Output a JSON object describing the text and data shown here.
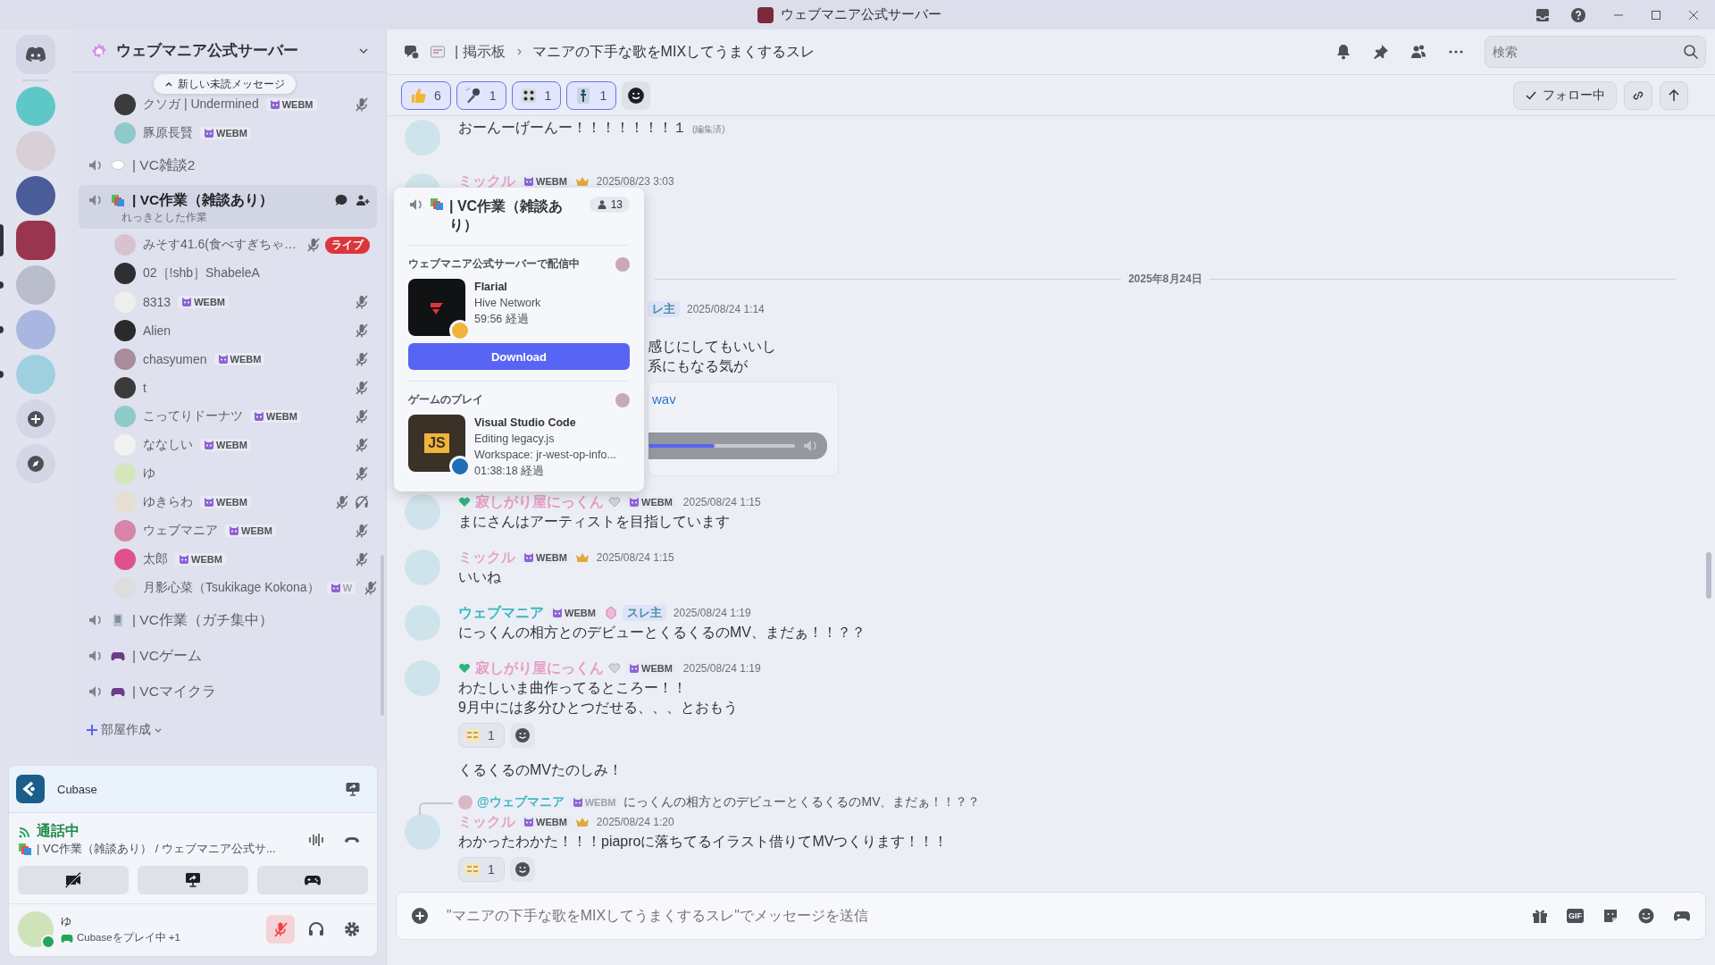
{
  "title_bar": {
    "title": "ウェブマニア公式サーバー"
  },
  "servers": [
    {
      "selected": false,
      "unread": false
    },
    {
      "selected": false,
      "unread": false
    },
    {
      "selected": false,
      "unread": false
    },
    {
      "selected": true,
      "unread": false
    },
    {
      "selected": false,
      "unread": true
    },
    {
      "selected": false,
      "unread": true
    },
    {
      "selected": false,
      "unread": true
    }
  ],
  "server": {
    "name": "ウェブマニア公式サーバー"
  },
  "new_messages_pill": "新しい未読メッセージ",
  "top_members": [
    {
      "name": "クソガ | Undermined",
      "tag": "WEBM",
      "muted": true,
      "deafened": false
    },
    {
      "name": "豚原長賢",
      "tag": "WEBM",
      "muted": false,
      "deafened": false
    }
  ],
  "channels": [
    {
      "name": "| VC雑談2",
      "kind": "speech",
      "selected": false
    },
    {
      "name": "| VC作業（雑談あり）",
      "kind": "books",
      "selected": true,
      "topic": "れっきとした作業",
      "members": [
        {
          "name": "みそす41.6(食べすぎちゃ…",
          "muted": true,
          "deafened": false,
          "live": "ライブ"
        },
        {
          "name": "02［!shb］ShabeleA",
          "muted": false,
          "deafened": false
        },
        {
          "name": "8313",
          "tag": "WEBM",
          "muted": true,
          "deafened": false
        },
        {
          "name": "Alien",
          "muted": true,
          "deafened": false
        },
        {
          "name": "chasyumen",
          "tag": "WEBM",
          "muted": true,
          "deafened": false
        },
        {
          "name": "t",
          "muted": true,
          "deafened": false
        },
        {
          "name": "こってりドーナツ",
          "tag": "WEBM",
          "muted": true,
          "deafened": false
        },
        {
          "name": "ななしい",
          "tag": "WEBM",
          "muted": true,
          "deafened": false
        },
        {
          "name": "ゆ",
          "muted": true,
          "deafened": false
        },
        {
          "name": "ゆきらわ",
          "tag": "WEBM",
          "muted": true,
          "deafened": true
        },
        {
          "name": "ウェブマニア",
          "tag": "WEBM",
          "muted": true,
          "deafened": false
        },
        {
          "name": "太郎",
          "tag": "WEBM",
          "muted": true,
          "deafened": false
        },
        {
          "name": "月影心菜（Tsukikage Kokona）",
          "tag": "W",
          "muted": true,
          "deafened": false
        }
      ]
    },
    {
      "name": "| VC作業（ガチ集中）",
      "kind": "building",
      "selected": false
    },
    {
      "name": "| VCゲーム",
      "kind": "gamepad",
      "selected": false
    },
    {
      "name": "| VCマイクラ",
      "kind": "gamepad",
      "selected": false
    }
  ],
  "create_room": "部屋作成",
  "voice_panel": {
    "activity": "Cubase",
    "status": "通話中",
    "location": "| VC作業（雑談あり） / ウェブマニア公式サ...",
    "camera_on": false
  },
  "user": {
    "name": "ゆ",
    "activity": "Cubaseをプレイ中 +1",
    "online": true,
    "mic_muted": true
  },
  "header": {
    "channel": "| 掲示板",
    "thread": "マニアの下手な歌をMIXしてうまくするスレ",
    "search": {
      "placeholder": "検索"
    }
  },
  "thread_reactions": [
    {
      "kind": "thumbs",
      "count": "6",
      "selected": true
    },
    {
      "kind": "mic",
      "count": "1",
      "selected": true
    },
    {
      "kind": "dice",
      "count": "1",
      "selected": true
    },
    {
      "kind": "figure",
      "count": "1",
      "selected": true
    }
  ],
  "follow_button": {
    "label": "フォロー中",
    "following": true
  },
  "messages": [
    {
      "kind": "text_only",
      "lines": [
        "おーんーげーんー！！！！！！！１"
      ],
      "edited": "(編集済)"
    },
    {
      "kind": "header_only",
      "author": "ミックル",
      "color": "#e3a6c8",
      "tag": "WEBM",
      "crown": true,
      "time": "2025/08/23 3:03"
    },
    {
      "kind": "divider",
      "label": "2025年8月24日"
    },
    {
      "kind": "partial",
      "badge": "レ主",
      "time": "2025/08/24 1:14",
      "lines": [
        "感じにしてもいいし",
        "系にもなる気が"
      ],
      "file": "wav",
      "level": 0.45
    },
    {
      "kind": "message",
      "author": "寂しがり屋にっくん",
      "color": "#e79cc3",
      "heart": true,
      "grey_heart": true,
      "tag": "WEBM",
      "time": "2025/08/24 1:15",
      "lines": [
        "まにさんはアーティストを目指しています"
      ]
    },
    {
      "kind": "message",
      "author": "ミックル",
      "color": "#e3a6c8",
      "tag": "WEBM",
      "crown": true,
      "time": "2025/08/24 1:15",
      "lines": [
        "いいね"
      ]
    },
    {
      "kind": "message",
      "author": "ウェブマニア",
      "color": "#3fb6c4",
      "tag": "WEBM",
      "gem": true,
      "badge": "スレ主",
      "time": "2025/08/24 1:19",
      "lines": [
        "にっくんの相方とのデビューとくるくるのMV、まだぁ！！？？"
      ]
    },
    {
      "kind": "message",
      "author": "寂しがり屋にっくん",
      "color": "#e79cc3",
      "heart": true,
      "grey_heart": true,
      "tag": "WEBM",
      "time": "2025/08/24 1:19",
      "lines": [
        "わたしいま曲作ってるところー！！",
        "9月中には多分ひとつだせる、、、とおもう"
      ],
      "reactions": [
        {
          "count": "1",
          "selected": false
        }
      ]
    },
    {
      "kind": "continuation",
      "lines": [
        "くるくるのMVたのしみ！"
      ]
    },
    {
      "kind": "message",
      "reply": {
        "author": "@ウェブマニア",
        "color": "#3fb6c4",
        "tag": "WEBM",
        "text": "にっくんの相方とのデビューとくるくるのMV、まだぁ！！？？"
      },
      "author": "ミックル",
      "color": "#e3a6c8",
      "tag": "WEBM",
      "crown": true,
      "time": "2025/08/24 1:20",
      "lines": [
        "わかったわかた！！！piaproに落ちてるイラスト借りてMVつくります！！！"
      ],
      "reactions": [
        {
          "count": "1",
          "selected": false
        }
      ]
    }
  ],
  "popup": {
    "channel": "| VC作業（雑談あり）",
    "count": "13",
    "sections": [
      {
        "kind": "stream",
        "title": "ウェブマニア公式サーバーで配信中",
        "app": "Flarial",
        "lines": [
          "Hive Network",
          "59:56 経過"
        ],
        "button": "Download"
      },
      {
        "kind": "game",
        "title": "ゲームのプレイ",
        "app": "Visual Studio Code",
        "logo_text": "JS",
        "lines": [
          "Editing legacy.js",
          "Workspace: jr-west-op-info...",
          "01:38:18 経過"
        ]
      }
    ]
  },
  "composer": {
    "placeholder": "\"マニアの下手な歌をMIXしてうまくするスレ\"でメッセージを送信",
    "gif": "GIF"
  }
}
